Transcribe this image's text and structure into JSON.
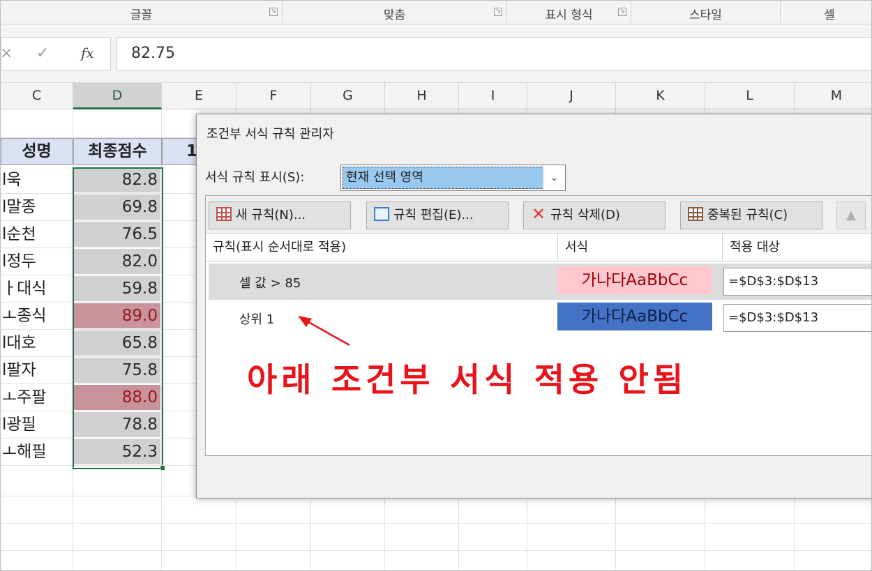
{
  "ribbon": {
    "groups": [
      {
        "label": "글꼴"
      },
      {
        "label": "맞춤"
      },
      {
        "label": "표시 형식"
      },
      {
        "label": "스타일"
      },
      {
        "label": "셀"
      }
    ]
  },
  "formula_bar": {
    "cancel_icon": "×",
    "enter_icon": "✓",
    "fx_icon": "fx",
    "value": "82.75"
  },
  "columns": [
    "C",
    "D",
    "E",
    "F",
    "G",
    "H",
    "I",
    "J",
    "K",
    "L",
    "M"
  ],
  "sheet": {
    "header_c": "성명",
    "header_d": "최종점수",
    "header_e": "1",
    "rows": [
      {
        "name": "l욱",
        "score": "82.8",
        "hl": false
      },
      {
        "name": "l말종",
        "score": "69.8",
        "hl": false
      },
      {
        "name": "l순천",
        "score": "76.5",
        "hl": false
      },
      {
        "name": "l정두",
        "score": "82.0",
        "hl": false
      },
      {
        "name": "ㅏ대식",
        "score": "59.8",
        "hl": false
      },
      {
        "name": "ㅗ종식",
        "score": "89.0",
        "hl": true
      },
      {
        "name": "l대호",
        "score": "65.8",
        "hl": false
      },
      {
        "name": "l팔자",
        "score": "75.8",
        "hl": false
      },
      {
        "name": "ㅗ주팔",
        "score": "88.0",
        "hl": true
      },
      {
        "name": "l광필",
        "score": "78.8",
        "hl": false
      },
      {
        "name": "ㅗ해필",
        "score": "52.3",
        "hl": false
      }
    ]
  },
  "dialog": {
    "title": "조건부 서식 규칙 관리자",
    "show_label": "서식 규칙 표시(S):",
    "show_value": "현재 선택 영역",
    "buttons": {
      "new": "새 규칙(N)...",
      "edit": "규칙 편집(E)...",
      "delete": "규칙 삭제(D)",
      "duplicate": "중복된 규칙(C)",
      "up_arrow": "▲"
    },
    "list_headers": {
      "rule": "규칙(표시 순서대로 적용)",
      "format": "서식",
      "applies_to": "적용 대상"
    },
    "rules": [
      {
        "name": "셀 값 > 85",
        "preview": "가나다AaBbCc",
        "range": "=$D$3:$D$13"
      },
      {
        "name": "상위 1",
        "preview": "가나다AaBbCc",
        "range": "=$D$3:$D$13"
      }
    ],
    "annotation": "아래 조건부 서식 적용 안됨"
  },
  "colors": {
    "selection_green": "#217346",
    "highlight_fill": "#c8939d",
    "highlight_text": "#9b1a1a",
    "gray_fill": "#d0d0d0",
    "preview_pink": "#ffc7ce",
    "preview_blue": "#4472c4",
    "annotation_red": "#e8141c"
  }
}
